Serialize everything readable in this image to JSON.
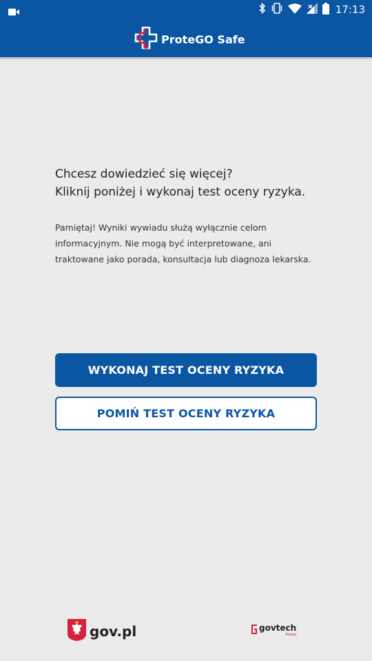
{
  "status_bar": {
    "time": "17:13",
    "icons": [
      "video-camera-icon",
      "bluetooth-icon",
      "vibrate-icon",
      "wifi-icon",
      "cellular-signal-icon",
      "battery-icon"
    ]
  },
  "header": {
    "app_name": "ProteGO Safe",
    "logo_icon": "medical-cross-logo-icon"
  },
  "main": {
    "headline_line1": "Chcesz dowiedzieć się więcej?",
    "headline_line2": "Kliknij poniżej i wykonaj test oceny ryzyka.",
    "notice": "Pamiętaj! Wyniki wywiadu służą wyłącznie celom informacyjnym. Nie mogą być interpretowane, ani traktowane jako porada, konsultacja lub diagnoza lekarska."
  },
  "actions": {
    "primary_label": "WYKONAJ TEST OCENY RYZYKA",
    "secondary_label": "POMIŃ TEST OCENY RYZYKA"
  },
  "footer": {
    "gov_label": "gov.pl",
    "govtech_label": "govtech",
    "govtech_sub": "Polska"
  },
  "colors": {
    "brand_blue": "#0b56a3",
    "background": "#ebebeb",
    "logo_red": "#d4213d"
  }
}
